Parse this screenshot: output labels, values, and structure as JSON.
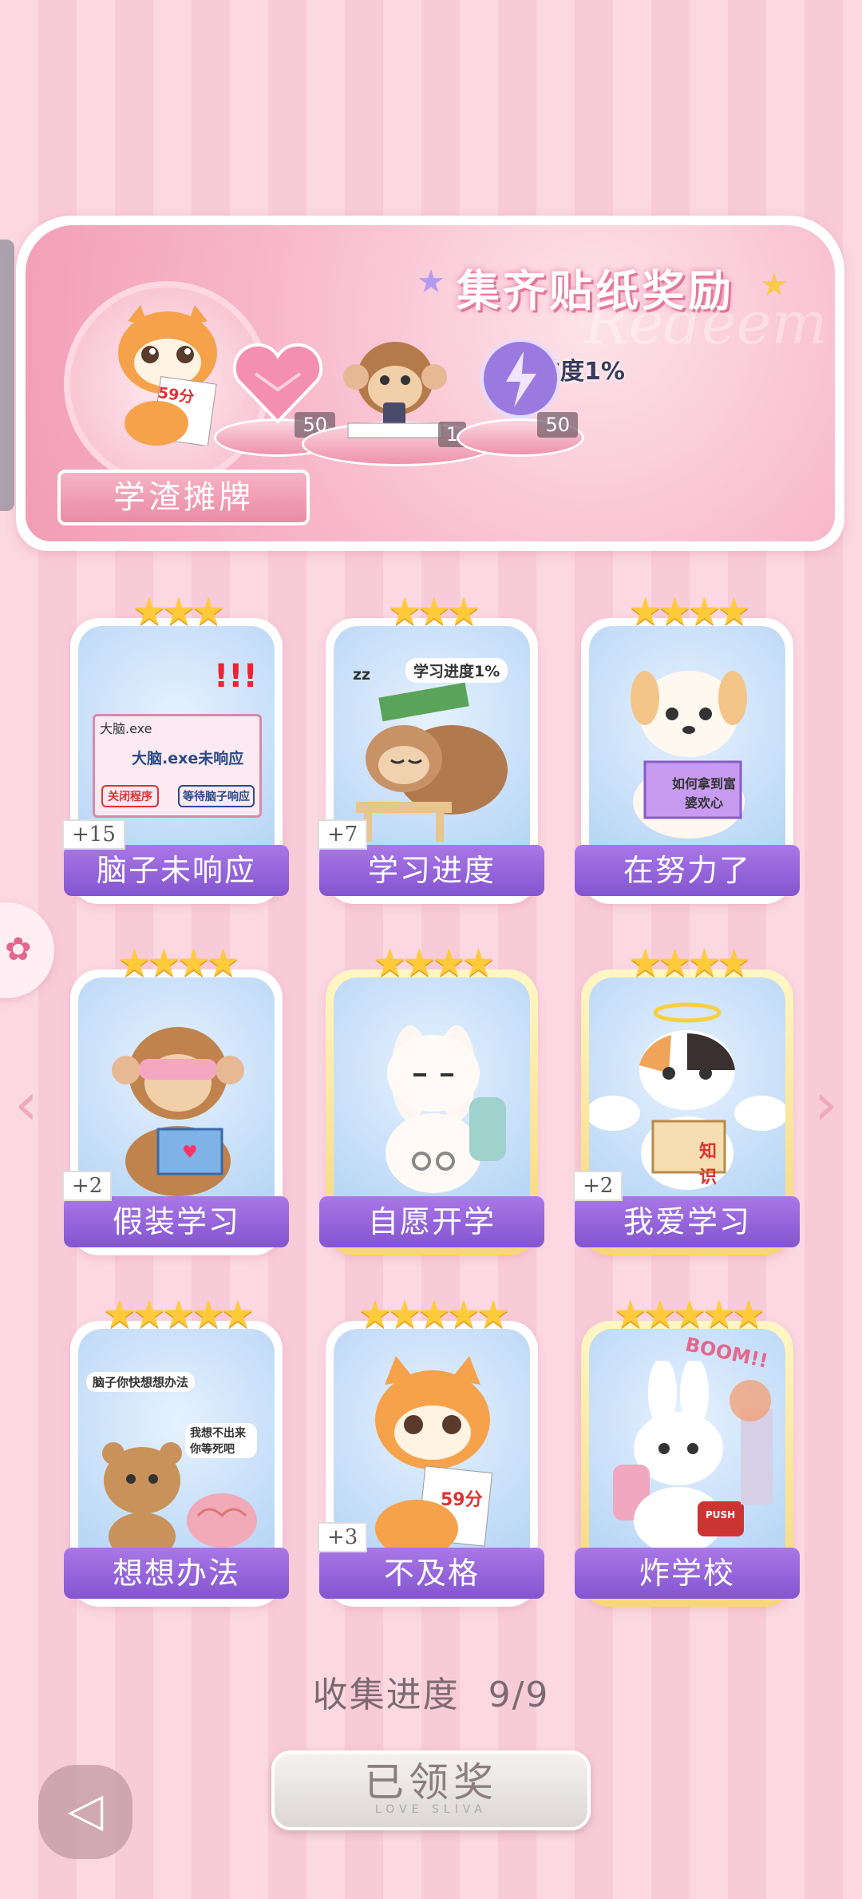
{
  "banner": {
    "title": "集齐贴纸奖励",
    "watermark": "Redeem",
    "name_plate": "学渣摊牌",
    "score_paper": "59分",
    "progress_bubble": "学习进度1%",
    "rewards": [
      {
        "icon": "pink-heart-gem-icon",
        "count": "50"
      },
      {
        "icon": "monkey-phone-sticker-icon",
        "count": "1"
      },
      {
        "icon": "purple-lightning-orb-icon",
        "count": "50"
      }
    ]
  },
  "cards": [
    {
      "label": "脑子未响应",
      "stars": "★★★",
      "plus": "+15",
      "art": "brain-not-responding-dialog",
      "texts": [
        "大脑.exe",
        "大脑.exe未响应",
        "关闭程序",
        "等待脑子响应"
      ]
    },
    {
      "label": "学习进度",
      "stars": "★★★",
      "plus": "+7",
      "art": "sleeping-sloth-books",
      "texts": [
        "学习进度1%",
        "zz"
      ]
    },
    {
      "label": "在努力了",
      "stars": "★★★★",
      "plus": "",
      "art": "puppy-reading-book",
      "texts": [
        "如何拿到富婆欢心"
      ]
    },
    {
      "label": "假装学习",
      "stars": "★★★★",
      "plus": "+2",
      "art": "monkey-blindfold-reading",
      "texts": []
    },
    {
      "label": "自愿开学",
      "stars": "★★★★",
      "plus": "",
      "art": "bunny-handcuffed-backpack",
      "texts": []
    },
    {
      "label": "我爱学习",
      "stars": "★★★★",
      "plus": "+2",
      "art": "angel-cat-knowledge-book",
      "texts": [
        "知识"
      ]
    },
    {
      "label": "想想办法",
      "stars": "★★★★★",
      "plus": "",
      "art": "bear-and-brain",
      "texts": [
        "脑子你快想想办法",
        "我想不出来你等死吧"
      ]
    },
    {
      "label": "不及格",
      "stars": "★★★★★",
      "plus": "+3",
      "art": "tiger-59-paper",
      "texts": [
        "59分"
      ]
    },
    {
      "label": "炸学校",
      "stars": "★★★★★",
      "plus": "",
      "art": "bunny-detonator-boom",
      "texts": [
        "BOOM!!",
        "PUSH"
      ]
    }
  ],
  "collection": {
    "label": "收集进度",
    "value": "9/9"
  },
  "claim_button": {
    "label": "已领奖",
    "sub": "LOVE SLIVA"
  },
  "nav": {
    "prev": "‹",
    "next": "›"
  },
  "colors": {
    "accent": "#8355cf",
    "pink": "#f19db6",
    "star": "#ffcb3a"
  }
}
